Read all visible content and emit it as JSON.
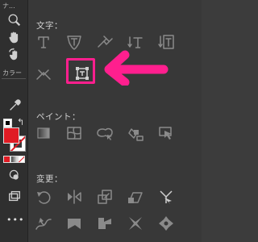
{
  "toolbar": {
    "title": "ナ...",
    "color_label": "カラー",
    "more_label": "•••",
    "fill_color": "#e01b24",
    "stroke_color": "#ffffff",
    "accent_red": "#e01b24",
    "icons": [
      "search-icon",
      "hand-icon",
      "rotate-view-icon",
      "eyedropper-icon",
      "swap-colors-icon",
      "default-colors-icon",
      "color-mode-icon",
      "drawing-mode-icon",
      "screen-mode-icon"
    ]
  },
  "panel": {
    "sections": [
      {
        "key": "type",
        "label": "文字：",
        "tools": [
          "type-tool",
          "area-type-tool",
          "type-on-path-tool",
          "vertical-type-tool",
          "vertical-area-type-tool",
          "touch-type-tool",
          "text-frame-tool"
        ]
      },
      {
        "key": "paint",
        "label": "ペイント：",
        "tools": [
          "gradient-tool",
          "mesh-tool",
          "shape-builder-tool",
          "live-paint-bucket-tool",
          "live-paint-selection-tool"
        ]
      },
      {
        "key": "modify",
        "label": "変更：",
        "tools": [
          "rotate-tool",
          "reflect-tool",
          "scale-tool",
          "shear-tool",
          "reshape-tool",
          "width-tool",
          "warp-tool",
          "twirl-tool",
          "pucker-tool",
          "bloat-tool"
        ]
      }
    ],
    "highlight": {
      "tool": "text-frame-tool",
      "color": "#ff1f8e"
    }
  }
}
